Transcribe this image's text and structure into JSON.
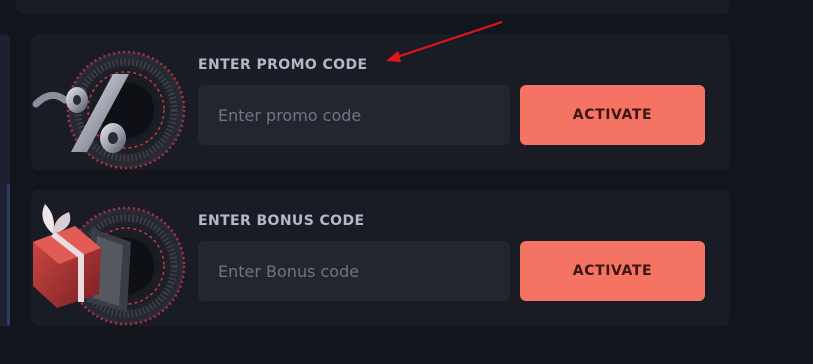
{
  "promo": {
    "title": "ENTER PROMO CODE",
    "placeholder": "Enter promo code",
    "value": "",
    "button_label": "ACTIVATE"
  },
  "bonus": {
    "title": "ENTER BONUS CODE",
    "placeholder": "Enter Bonus code",
    "value": "",
    "button_label": "ACTIVATE"
  },
  "colors": {
    "background": "#13151d",
    "card": "#1a1c25",
    "input": "#23252f",
    "accent": "#f47362",
    "button_text": "#3b1510",
    "title_text": "#b3b8c9",
    "annotation_arrow": "#e0141c"
  },
  "icons": [
    "percent-icon",
    "gift-icon"
  ]
}
